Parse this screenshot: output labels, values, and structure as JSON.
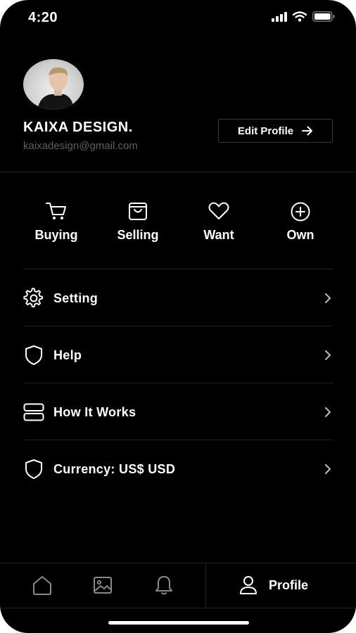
{
  "status_bar": {
    "time": "4:20"
  },
  "profile": {
    "name": "KAIXA DESIGN.",
    "email": "kaixadesign@gmail.com",
    "edit_label": "Edit Profile"
  },
  "quick_actions": [
    {
      "label": "Buying",
      "icon": "cart-icon"
    },
    {
      "label": "Selling",
      "icon": "shopping-bag-icon"
    },
    {
      "label": "Want",
      "icon": "heart-icon"
    },
    {
      "label": "Own",
      "icon": "plus-circle-icon"
    }
  ],
  "menu": [
    {
      "label": "Setting",
      "icon": "gear-icon"
    },
    {
      "label": "Help",
      "icon": "shield-icon"
    },
    {
      "label": "How It Works",
      "icon": "server-icon"
    },
    {
      "label": "Currency: US$ USD",
      "icon": "shield-icon"
    }
  ],
  "tab_bar": {
    "items": [
      {
        "icon": "home-icon"
      },
      {
        "icon": "image-icon"
      },
      {
        "icon": "bell-icon"
      }
    ],
    "active_label": "Profile"
  },
  "colors": {
    "background": "#000000",
    "text": "#ffffff",
    "muted": "#5f5f5f",
    "divider": "#222222"
  }
}
